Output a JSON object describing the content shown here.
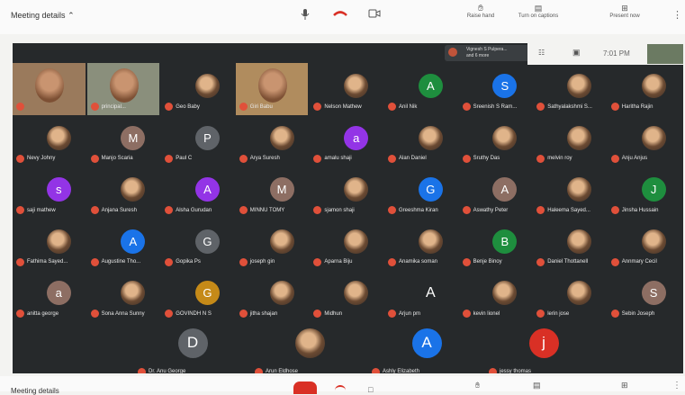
{
  "topbar": {
    "meeting_details": "Meeting details",
    "raise_hand": "Raise hand",
    "captions": "Turn on captions",
    "present": "Present now"
  },
  "presenter": {
    "line1": "Vignesh S Pulpera...",
    "line2": "and 6 more"
  },
  "self_view": {
    "time": "7:01 PM"
  },
  "bottombar": {
    "meeting_details": "Meeting details"
  },
  "participants": [
    {
      "name": "",
      "kind": "video"
    },
    {
      "name": "principal...",
      "kind": "video"
    },
    {
      "name": "Geo Baby",
      "kind": "photo"
    },
    {
      "name": "Giri Babu",
      "kind": "video"
    },
    {
      "name": "Nelson Mathew",
      "kind": "photo"
    },
    {
      "name": "Anil Nik",
      "kind": "letter",
      "letter": "A",
      "color": "#1e8e3e"
    },
    {
      "name": "Sreenish S Ram...",
      "kind": "letter",
      "letter": "S",
      "color": "#1a73e8"
    },
    {
      "name": "Sathyalakshmi S...",
      "kind": "photo"
    },
    {
      "name": "Haritha Rajin",
      "kind": "photo"
    },
    {
      "name": "Nevy Johny",
      "kind": "photo"
    },
    {
      "name": "Manjo Scaria",
      "kind": "letter",
      "letter": "M",
      "color": "#8d6e63"
    },
    {
      "name": "Paul C",
      "kind": "letter",
      "letter": "P",
      "color": "#5f6368"
    },
    {
      "name": "Arya Suresh",
      "kind": "photo"
    },
    {
      "name": "amalu shaji",
      "kind": "letter",
      "letter": "a",
      "color": "#9334e6"
    },
    {
      "name": "Alan Daniel",
      "kind": "photo"
    },
    {
      "name": "Sruthy Das",
      "kind": "photo"
    },
    {
      "name": "melvin roy",
      "kind": "photo"
    },
    {
      "name": "Anju Anjus",
      "kind": "photo"
    },
    {
      "name": "saji mathew",
      "kind": "letter",
      "letter": "s",
      "color": "#9334e6"
    },
    {
      "name": "Anjana Suresh",
      "kind": "photo"
    },
    {
      "name": "Alsha Gurudan",
      "kind": "letter",
      "letter": "A",
      "color": "#9334e6"
    },
    {
      "name": "MINNU TOMY",
      "kind": "letter",
      "letter": "M",
      "color": "#8d6e63"
    },
    {
      "name": "sjamon shaji",
      "kind": "photo"
    },
    {
      "name": "Greeshma Kiran",
      "kind": "letter",
      "letter": "G",
      "color": "#1a73e8"
    },
    {
      "name": "Aswathy Peter",
      "kind": "letter",
      "letter": "A",
      "color": "#8d6e63"
    },
    {
      "name": "Haleema Sayed...",
      "kind": "photo"
    },
    {
      "name": "Jinsha Hussain",
      "kind": "letter",
      "letter": "J",
      "color": "#1e8e3e"
    },
    {
      "name": "Fathima Sayed...",
      "kind": "photo"
    },
    {
      "name": "Augustine Tho...",
      "kind": "letter",
      "letter": "A",
      "color": "#1a73e8"
    },
    {
      "name": "Gopika Ps",
      "kind": "letter",
      "letter": "G",
      "color": "#5f6368"
    },
    {
      "name": "joseph gin",
      "kind": "photo"
    },
    {
      "name": "Aparna Biju",
      "kind": "photo"
    },
    {
      "name": "Anamika soman",
      "kind": "photo"
    },
    {
      "name": "Benje Binoy",
      "kind": "letter",
      "letter": "B",
      "color": "#1e8e3e"
    },
    {
      "name": "Daniel Thottanell",
      "kind": "photo"
    },
    {
      "name": "Annmary Cecil",
      "kind": "photo"
    },
    {
      "name": "anitta george",
      "kind": "letter",
      "letter": "a",
      "color": "#8d6e63"
    },
    {
      "name": "Sona Anna Sunny",
      "kind": "photo"
    },
    {
      "name": "GOVINDH N S",
      "kind": "letter",
      "letter": "G",
      "color": "#c58a18"
    },
    {
      "name": "jitha shajan",
      "kind": "photo"
    },
    {
      "name": "Midhun",
      "kind": "photo"
    },
    {
      "name": "Arjun pm",
      "kind": "letter-plain",
      "letter": "A"
    },
    {
      "name": "kevin lionel",
      "kind": "photo"
    },
    {
      "name": "lerin jose",
      "kind": "photo"
    },
    {
      "name": "Sebin Joseph",
      "kind": "letter",
      "letter": "S",
      "color": "#8d6e63"
    },
    {
      "name": "Dr. Anu George",
      "kind": "letter",
      "letter": "D",
      "color": "#5f6368"
    },
    {
      "name": "Arun Eldhose",
      "kind": "photo"
    },
    {
      "name": "Ashly Elizabeth",
      "kind": "letter",
      "letter": "A",
      "color": "#1a73e8"
    },
    {
      "name": "jessy thomas",
      "kind": "letter",
      "letter": "j",
      "color": "#d93025"
    }
  ]
}
